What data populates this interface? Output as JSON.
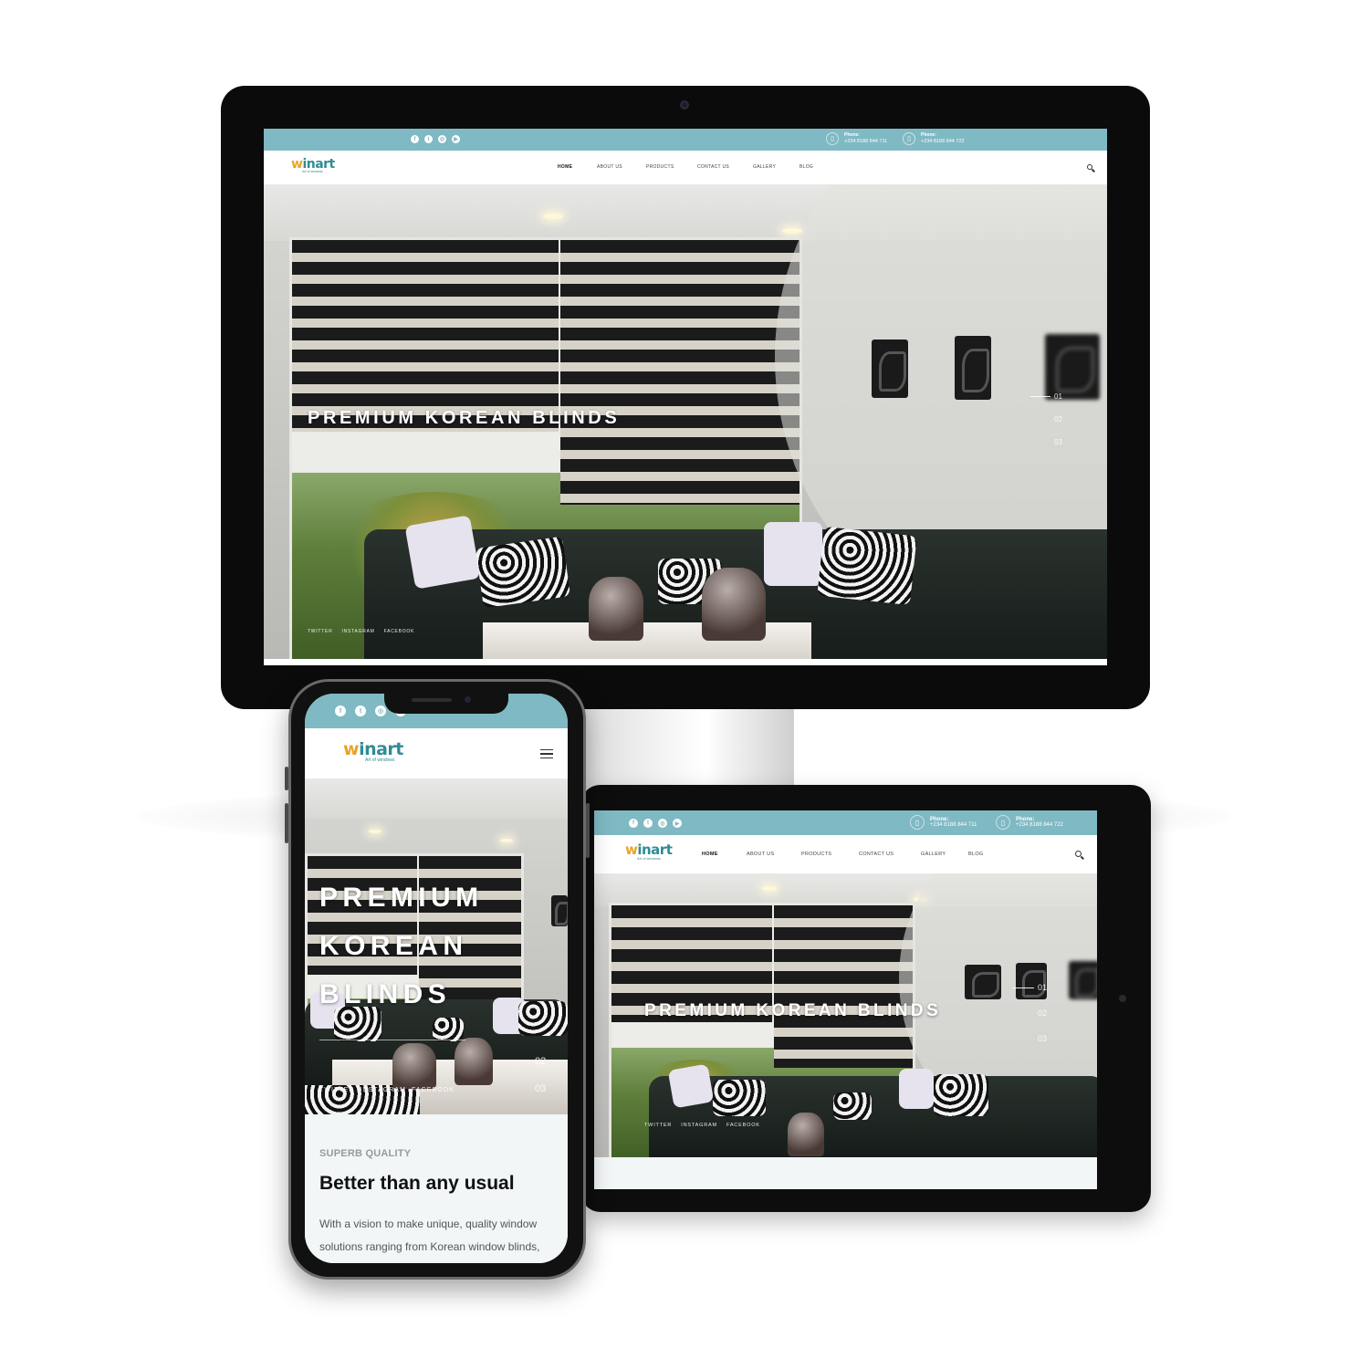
{
  "site": {
    "logo_text": "inart",
    "logo_w": "w",
    "logo_tagline": "Art of windows",
    "menu": [
      "HOME",
      "ABOUT US",
      "PRODUCTS",
      "CONTACT US",
      "GALLERY",
      "BLOG"
    ],
    "active_menu": "HOME",
    "social_icons": [
      "facebook-icon",
      "twitter-icon",
      "instagram-icon",
      "youtube-icon"
    ],
    "phones": [
      {
        "label": "Phone:",
        "number": "+234 8188 844 711"
      },
      {
        "label": "Phone:",
        "number": "+234 8188 844 722"
      }
    ]
  },
  "hero": {
    "title": "PREMIUM KOREAN BLINDS",
    "title_lines": [
      "PREMIUM",
      "KOREAN",
      "BLINDS"
    ],
    "slides": [
      "01",
      "02",
      "03"
    ],
    "active_slide": "01",
    "social_links": [
      "TWITTER",
      "INSTAGRAM",
      "FACEBOOK"
    ]
  },
  "about": {
    "eyebrow": "SUPERB QUALITY",
    "heading": "Better than any usual",
    "body": "With a vision to make unique, quality window solutions ranging from Korean window blinds,"
  },
  "colors": {
    "topbar": "#7fb9c3",
    "brand": "#2f8c95",
    "logo_accent": "#e8a42a"
  }
}
